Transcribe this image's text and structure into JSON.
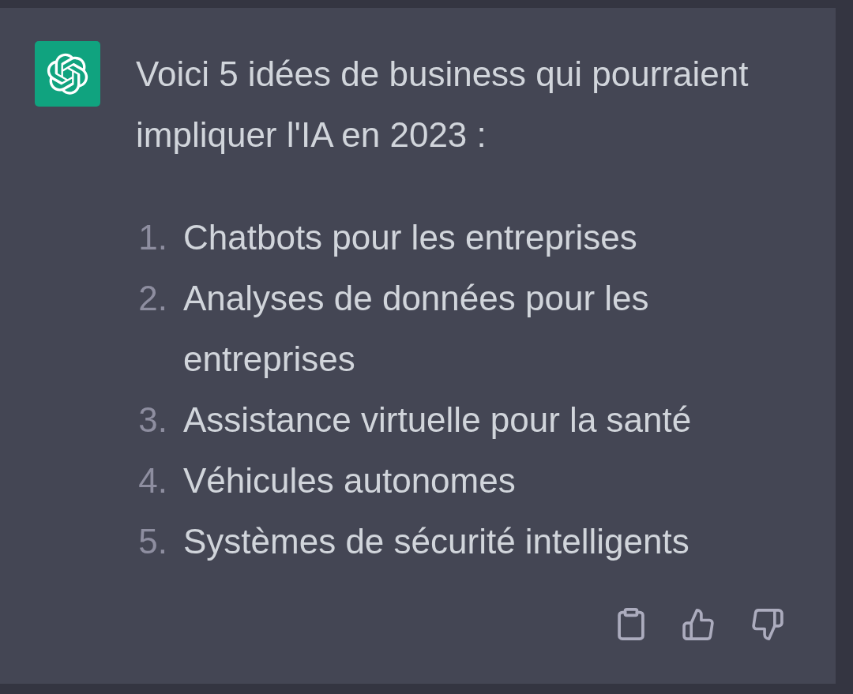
{
  "message": {
    "intro": "Voici 5 idées de business qui pourraient impliquer l'IA en 2023 :",
    "items": [
      {
        "number": "1.",
        "text": "Chatbots pour les entreprises"
      },
      {
        "number": "2.",
        "text": "Analyses de données pour les entreprises"
      },
      {
        "number": "3.",
        "text": "Assistance virtuelle pour la santé"
      },
      {
        "number": "4.",
        "text": "Véhicules autonomes"
      },
      {
        "number": "5.",
        "text": "Systèmes de sécurité intelligents"
      }
    ]
  }
}
